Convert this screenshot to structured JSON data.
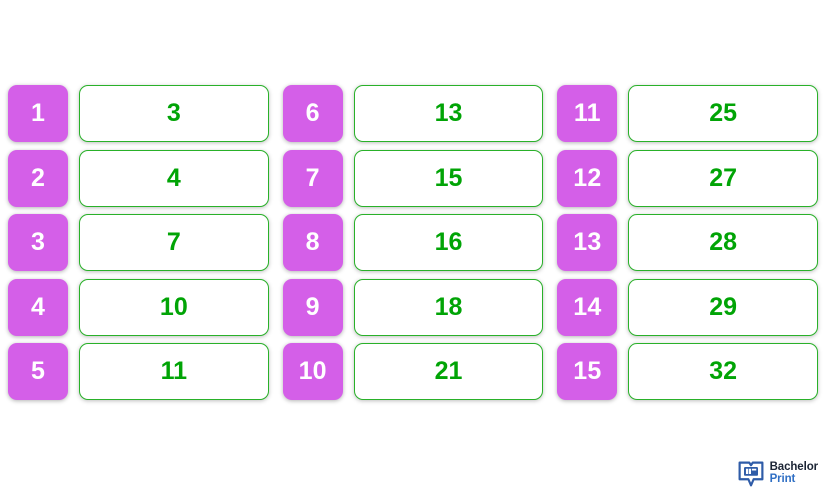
{
  "page": {
    "background_color": "#ffffff",
    "index_color": "#d45fe8",
    "index_text_color": "#ffffff",
    "value_text_color": "#01a406",
    "value_border_color": "#29b129"
  },
  "columns": [
    {
      "pairs": [
        {
          "index": "1",
          "value": "3"
        },
        {
          "index": "2",
          "value": "4"
        },
        {
          "index": "3",
          "value": "7"
        },
        {
          "index": "4",
          "value": "10"
        },
        {
          "index": "5",
          "value": "11"
        }
      ]
    },
    {
      "pairs": [
        {
          "index": "6",
          "value": "13"
        },
        {
          "index": "7",
          "value": "15"
        },
        {
          "index": "8",
          "value": "16"
        },
        {
          "index": "9",
          "value": "18"
        },
        {
          "index": "10",
          "value": "21"
        }
      ]
    },
    {
      "pairs": [
        {
          "index": "11",
          "value": "25"
        },
        {
          "index": "12",
          "value": "27"
        },
        {
          "index": "13",
          "value": "28"
        },
        {
          "index": "14",
          "value": "29"
        },
        {
          "index": "15",
          "value": "32"
        }
      ]
    }
  ],
  "logo": {
    "mark_label": "BP",
    "line1": "Bachelor",
    "line2": "Print",
    "mark_color": "#2f5ca8",
    "line1_color": "#1b2434",
    "line2_color": "#2f6fc4"
  }
}
